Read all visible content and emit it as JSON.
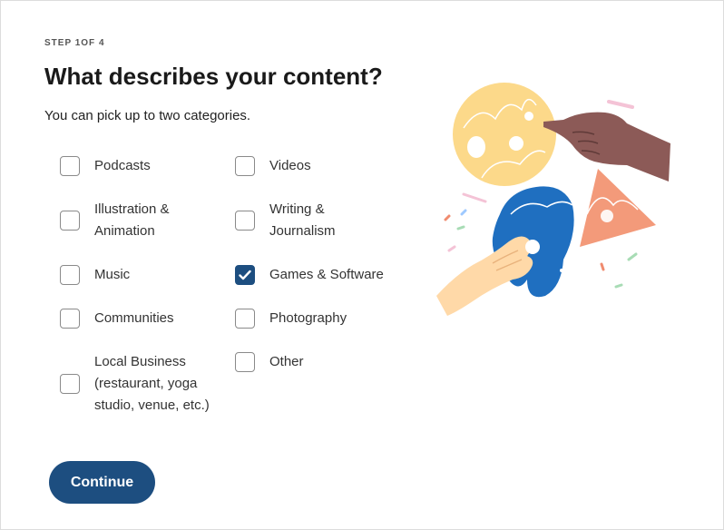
{
  "header": {
    "step": "STEP 1OF 4",
    "title": "What describes your content?",
    "subtitle": "You can pick up to two categories."
  },
  "options": [
    {
      "label_lines": [
        "Podcasts"
      ],
      "checked": false
    },
    {
      "label_lines": [
        "Videos"
      ],
      "checked": false
    },
    {
      "label_lines": [
        "Illustration &",
        "Animation"
      ],
      "checked": false
    },
    {
      "label_lines": [
        "Writing &",
        "Journalism"
      ],
      "checked": false
    },
    {
      "label_lines": [
        "Music"
      ],
      "checked": false
    },
    {
      "label_lines": [
        "Games & Software"
      ],
      "checked": true
    },
    {
      "label_lines": [
        "Communities"
      ],
      "checked": false
    },
    {
      "label_lines": [
        "Photography"
      ],
      "checked": false
    },
    {
      "label_lines": [
        "Local Business",
        "(restaurant, yoga",
        "studio, venue, etc.)"
      ],
      "checked": false
    },
    {
      "label_lines": [
        "Other"
      ],
      "checked": false
    }
  ],
  "actions": {
    "continue_label": "Continue"
  },
  "colors": {
    "accent": "#1d4e80",
    "checkbox_border": "#8a8a8a"
  },
  "icons": {
    "checkmark": "check-icon",
    "illustration": "hands-shapes-illustration"
  }
}
